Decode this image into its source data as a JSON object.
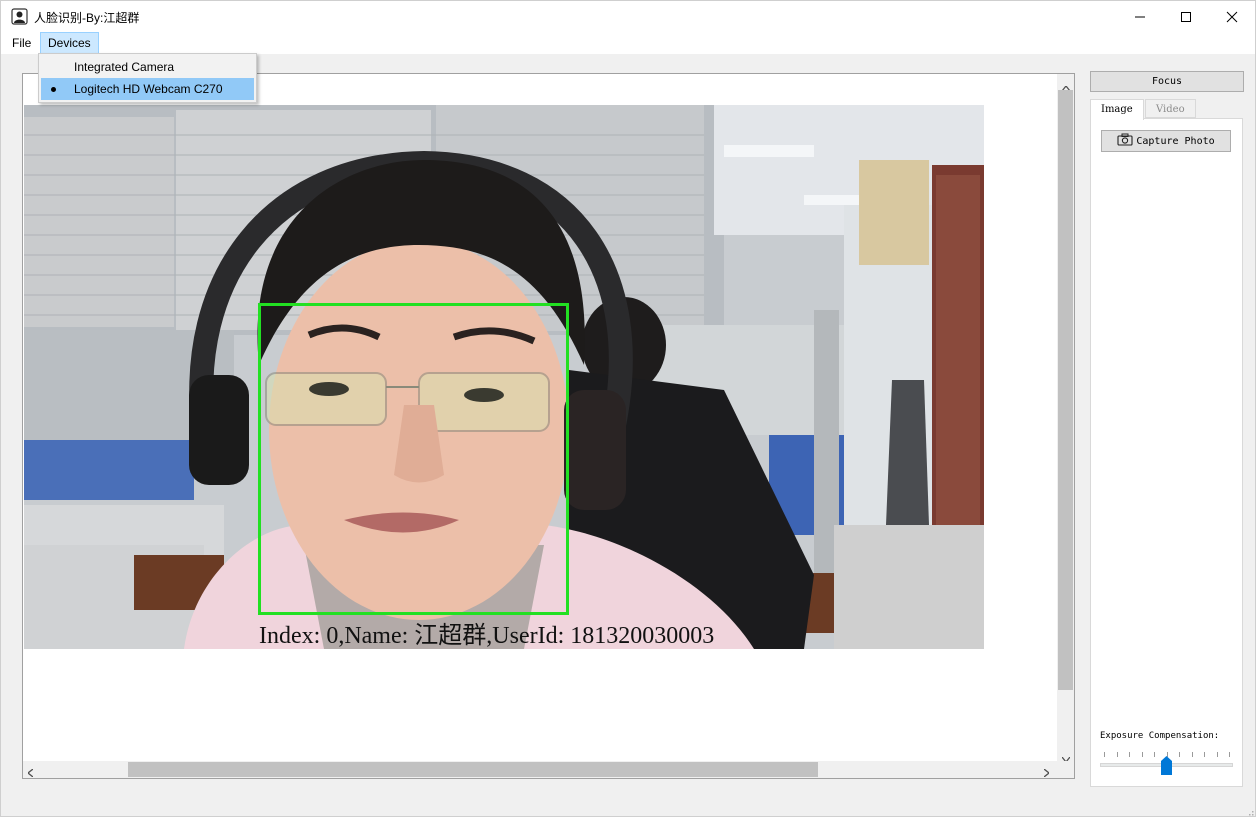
{
  "window": {
    "title": "人脸识别-By:江超群"
  },
  "menu": {
    "file_label": "File",
    "devices_label": "Devices"
  },
  "devices_dropdown": {
    "items": [
      {
        "label": "Integrated Camera",
        "selected": false
      },
      {
        "label": "Logitech HD Webcam C270",
        "selected": true
      }
    ]
  },
  "video": {
    "overlay_text": "Index: 0,Name: 江超群,UserId: 181320030003"
  },
  "right_panel": {
    "focus_label": "Focus",
    "tabs": [
      {
        "label": "Image",
        "active": true
      },
      {
        "label": "Video",
        "active": false
      }
    ],
    "capture_label": "Capture Photo",
    "exposure_label": "Exposure Compensation:",
    "exposure_level": 0.5,
    "exposure_ticks": 11
  },
  "colors": {
    "face_box": "#22e022",
    "menu_highlight": "#cce8ff",
    "selected_item": "#91c9f7",
    "slider_handle": "#0078d7"
  },
  "icons": {
    "app": "user-portrait-icon",
    "minimize": "minimize-icon",
    "maximize": "maximize-icon",
    "close": "close-icon",
    "camera": "camera-icon"
  }
}
